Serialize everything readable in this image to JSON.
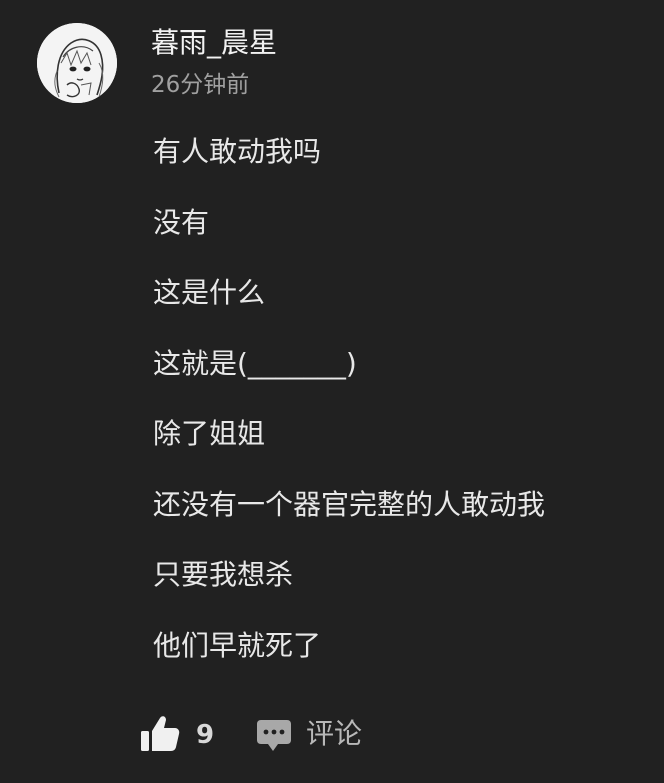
{
  "post": {
    "author": {
      "username": "暮雨_晨星",
      "avatar_icon": "anime-girl-avatar"
    },
    "timestamp": "26分钟前",
    "lines": [
      "有人敢动我吗",
      "没有",
      "这是什么",
      "这就是(_______)",
      "除了姐姐",
      "还没有一个器官完整的人敢动我",
      "只要我想杀",
      "他们早就死了"
    ]
  },
  "actions": {
    "like_icon": "thumbs-up-icon",
    "like_count": "9",
    "comment_icon": "comment-bubble-icon",
    "comment_label": "评论"
  },
  "colors": {
    "background": "#212121",
    "text": "#e8e8e8",
    "muted": "#a0a0a0"
  }
}
